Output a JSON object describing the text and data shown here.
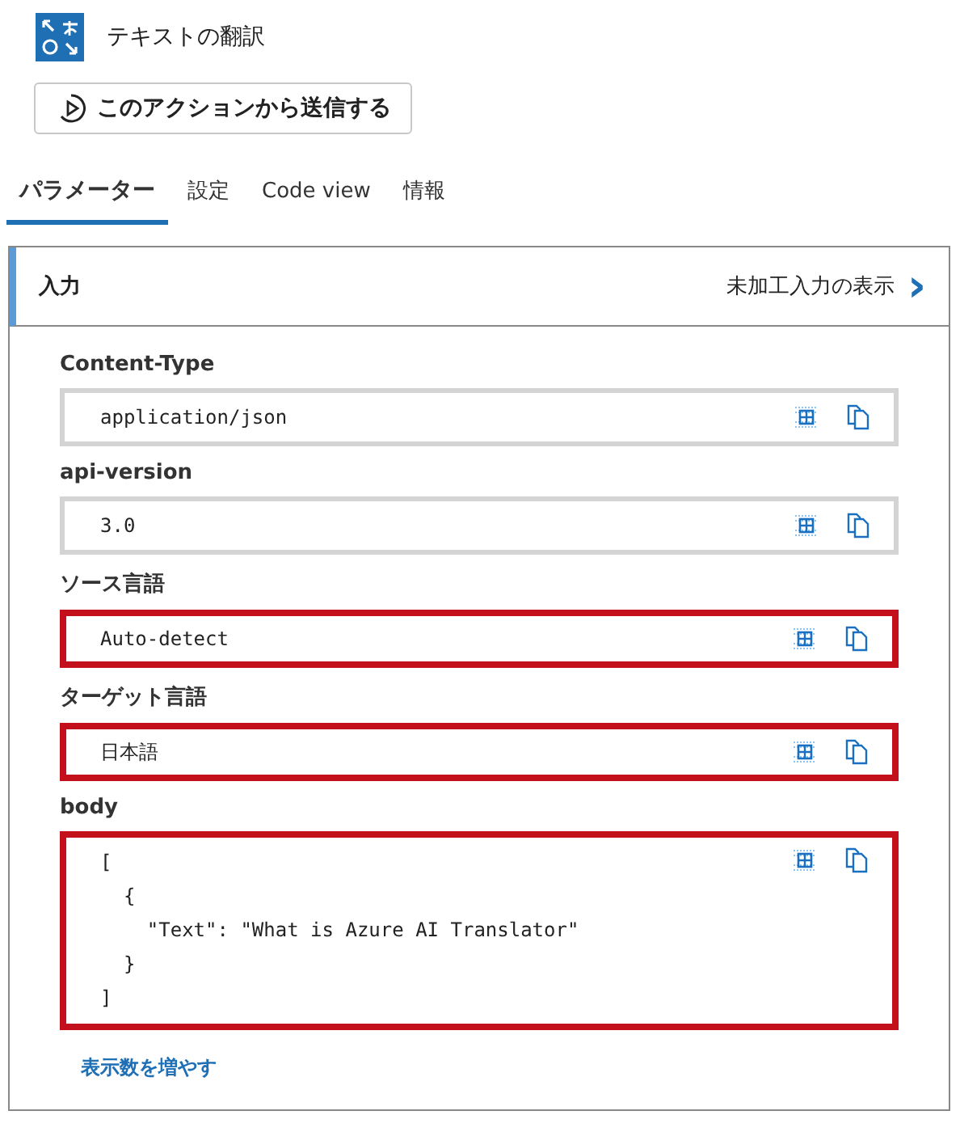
{
  "header": {
    "title": "テキストの翻訳"
  },
  "run_button": {
    "label": "このアクションから送信する"
  },
  "tabs": [
    {
      "label": "パラメーター",
      "selected": true
    },
    {
      "label": "設定",
      "selected": false
    },
    {
      "label": "Code view",
      "selected": false
    },
    {
      "label": "情報",
      "selected": false
    }
  ],
  "panel": {
    "title": "入力",
    "raw_link": "未加工入力の表示",
    "raw_arrow": "›",
    "fields": [
      {
        "label": "Content-Type",
        "lines": [
          "application/json"
        ],
        "highlighted": false
      },
      {
        "label": "api-version",
        "lines": [
          "3.0"
        ],
        "highlighted": false
      },
      {
        "label": "ソース言語",
        "lines": [
          "Auto-detect"
        ],
        "highlighted": true
      },
      {
        "label": "ターゲット言語",
        "lines": [
          "日本語"
        ],
        "highlighted": true
      },
      {
        "label": "body",
        "lines": [
          "[",
          "  {",
          "    \"Text\": \"What is Azure AI Translator\"",
          "  }",
          "]"
        ],
        "highlighted": true
      }
    ],
    "show_more": "表示数を増やす"
  }
}
